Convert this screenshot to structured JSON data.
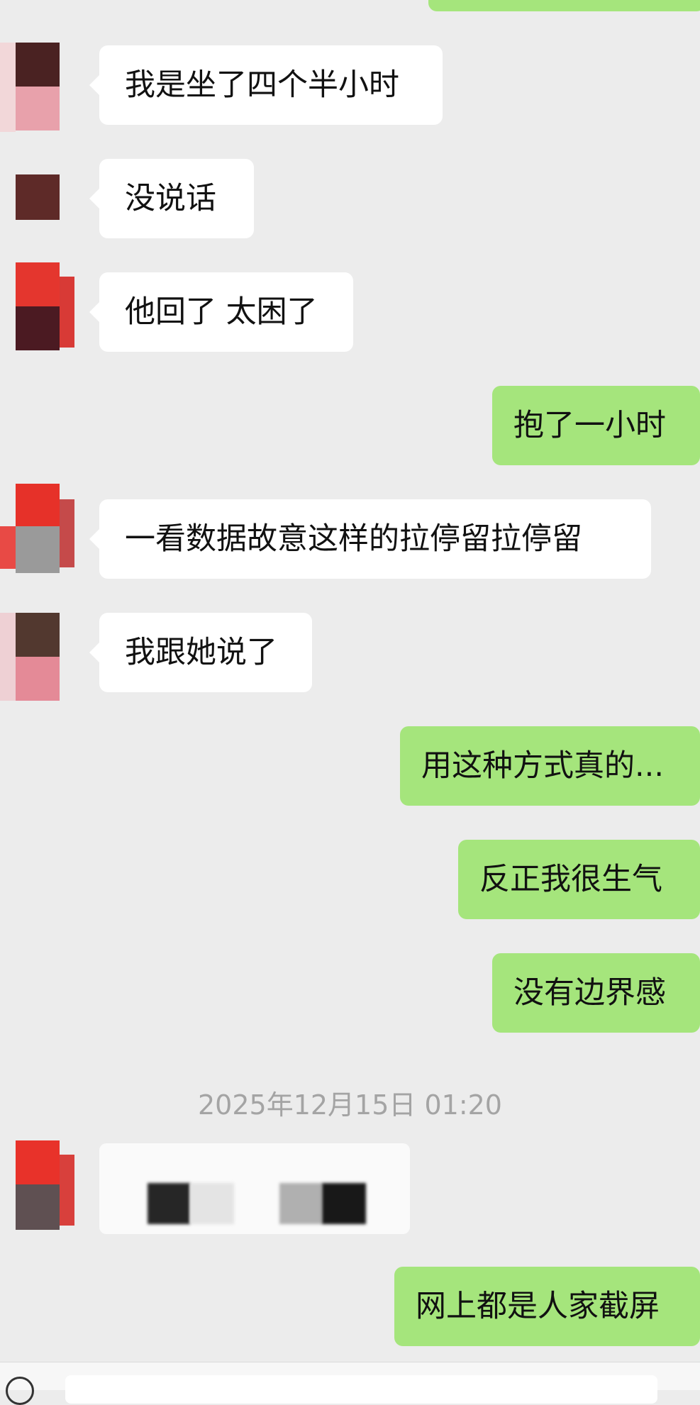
{
  "colors": {
    "background": "#ececec",
    "incoming_bubble": "#ffffff",
    "outgoing_bubble": "#a5e57c",
    "timestamp_text": "#a4a4a4"
  },
  "messages": [
    {
      "side": "incoming",
      "text": "我是坐了四个半小时"
    },
    {
      "side": "incoming",
      "text": "没说话"
    },
    {
      "side": "incoming",
      "text": "他回了 太困了"
    },
    {
      "side": "outgoing",
      "text": "抱了一小时"
    },
    {
      "side": "incoming",
      "text": "一看数据故意这样的拉停留拉停留"
    },
    {
      "side": "incoming",
      "text": "我跟她说了"
    },
    {
      "side": "outgoing",
      "text": "用这种方式真的..."
    },
    {
      "side": "outgoing",
      "text": "反正我很生气"
    },
    {
      "side": "outgoing",
      "text": "没有边界感"
    },
    {
      "side": "incoming",
      "type": "image-blurred"
    },
    {
      "side": "outgoing",
      "text": "网上都是人家截屏"
    }
  ],
  "timestamp": "2025年12月15日 01:20",
  "icons": {
    "voice": "voice-icon",
    "avatar": "avatar-pixelated"
  }
}
